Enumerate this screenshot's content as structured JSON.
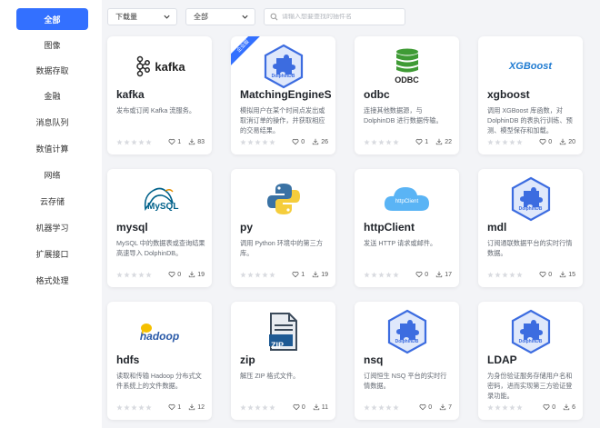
{
  "sidebar": {
    "items": [
      {
        "label": "全部",
        "active": true
      },
      {
        "label": "图像"
      },
      {
        "label": "数据存取"
      },
      {
        "label": "金融"
      },
      {
        "label": "消息队列"
      },
      {
        "label": "数值计算"
      },
      {
        "label": "网络"
      },
      {
        "label": "云存储"
      },
      {
        "label": "机器学习"
      },
      {
        "label": "扩展接口"
      },
      {
        "label": "格式处理"
      }
    ]
  },
  "filters": {
    "sort_value": "下载量",
    "category_value": "全部",
    "search_placeholder": "请输入想要查找的插件名"
  },
  "plugins": [
    {
      "name": "kafka",
      "desc": "发布或订阅 Kafka 流服务。",
      "likes": "1",
      "downloads": "83",
      "logo": "kafka-logo",
      "logo_text": "kafka"
    },
    {
      "name": "MatchingEngineSimulator",
      "desc": "模拟用户在某个时间点发出或取消订单的操作，并获取相应的交易结果。",
      "likes": "0",
      "downloads": "26",
      "logo": "dolphindb-logo",
      "logo_text": "DolphinDB",
      "ribbon": "企业版"
    },
    {
      "name": "odbc",
      "desc": "连接其他数据源，与 DolphinDB 进行数据传输。",
      "likes": "1",
      "downloads": "22",
      "logo": "odbc-logo",
      "logo_text": "ODBC"
    },
    {
      "name": "xgboost",
      "desc": "调用 XGBoost 库函数，对 DolphinDB 的表执行训练、预测、模型保存和加载。",
      "likes": "0",
      "downloads": "20",
      "logo": "xgboost-logo",
      "logo_text": "XGBoost"
    },
    {
      "name": "mysql",
      "desc": "MySQL 中的数据表或查询结果高速导入 DolphinDB。",
      "likes": "0",
      "downloads": "19",
      "logo": "mysql-logo",
      "logo_text": "MySQL"
    },
    {
      "name": "py",
      "desc": "调用 Python 环境中的第三方库。",
      "likes": "1",
      "downloads": "19",
      "logo": "python-logo",
      "logo_text": ""
    },
    {
      "name": "httpClient",
      "desc": "发送 HTTP 请求或邮件。",
      "likes": "0",
      "downloads": "17",
      "logo": "httpclient-logo",
      "logo_text": "httpClient"
    },
    {
      "name": "mdl",
      "desc": "订阅通联数据平台的实时行情数据。",
      "likes": "0",
      "downloads": "15",
      "logo": "dolphindb-logo",
      "logo_text": "DolphinDB"
    },
    {
      "name": "hdfs",
      "desc": "读取和传输 Hadoop 分布式文件系统上的文件数据。",
      "likes": "1",
      "downloads": "12",
      "logo": "hadoop-logo",
      "logo_text": "hadoop"
    },
    {
      "name": "zip",
      "desc": "解压 ZIP 格式文件。",
      "likes": "0",
      "downloads": "11",
      "logo": "zip-logo",
      "logo_text": "ZIP"
    },
    {
      "name": "nsq",
      "desc": "订阅恒生 NSQ 平台的实时行情数据。",
      "likes": "0",
      "downloads": "7",
      "logo": "dolphindb-logo",
      "logo_text": "DolphinDB"
    },
    {
      "name": "LDAP",
      "desc": "为身份验证服务存储用户名和密码，进而实现第三方验证登录功能。",
      "likes": "0",
      "downloads": "6",
      "logo": "dolphindb-logo",
      "logo_text": "DolphinDB"
    }
  ],
  "colors": {
    "accent": "#3370ff",
    "dolphindb": "#3c6ce0",
    "odbc": "#3f9b35",
    "xgboost": "#1f7bd1"
  }
}
